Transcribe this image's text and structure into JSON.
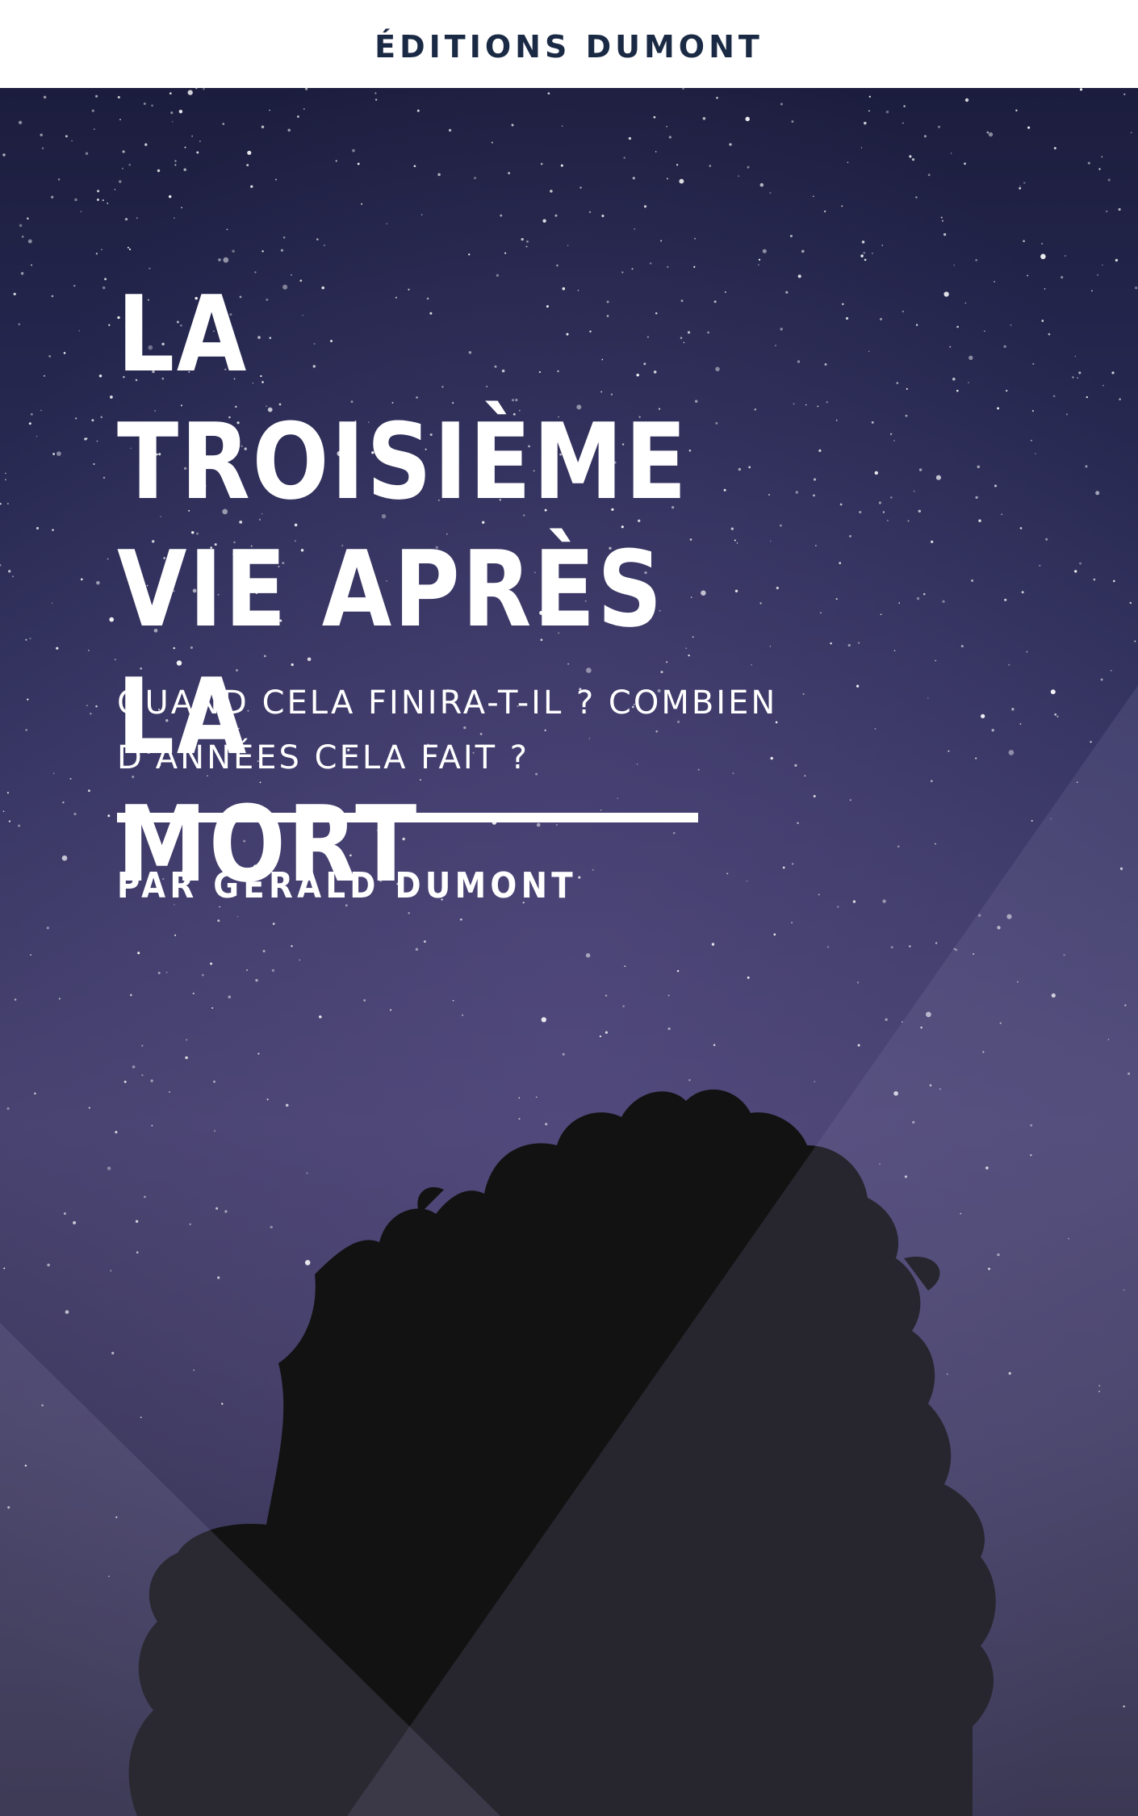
{
  "publisher": "ÉDITIONS DUMONT",
  "title": "LA TROISIÈME\nVIE APRÈS LA\nMORT",
  "subtitle": "QUAND CELA FINIRA-T-IL ? COMBIEN D'ANNÉES CELA FAIT ?",
  "author": "PAR GÉRALD DUMONT",
  "colors": {
    "publisher_text": "#1b2a44",
    "sky_top": "#1c1d3e",
    "sky_bottom": "#47426f",
    "text": "#ffffff",
    "tree": "#121212"
  },
  "icons": [
    "night-sky-photo",
    "tree-silhouette-image"
  ]
}
